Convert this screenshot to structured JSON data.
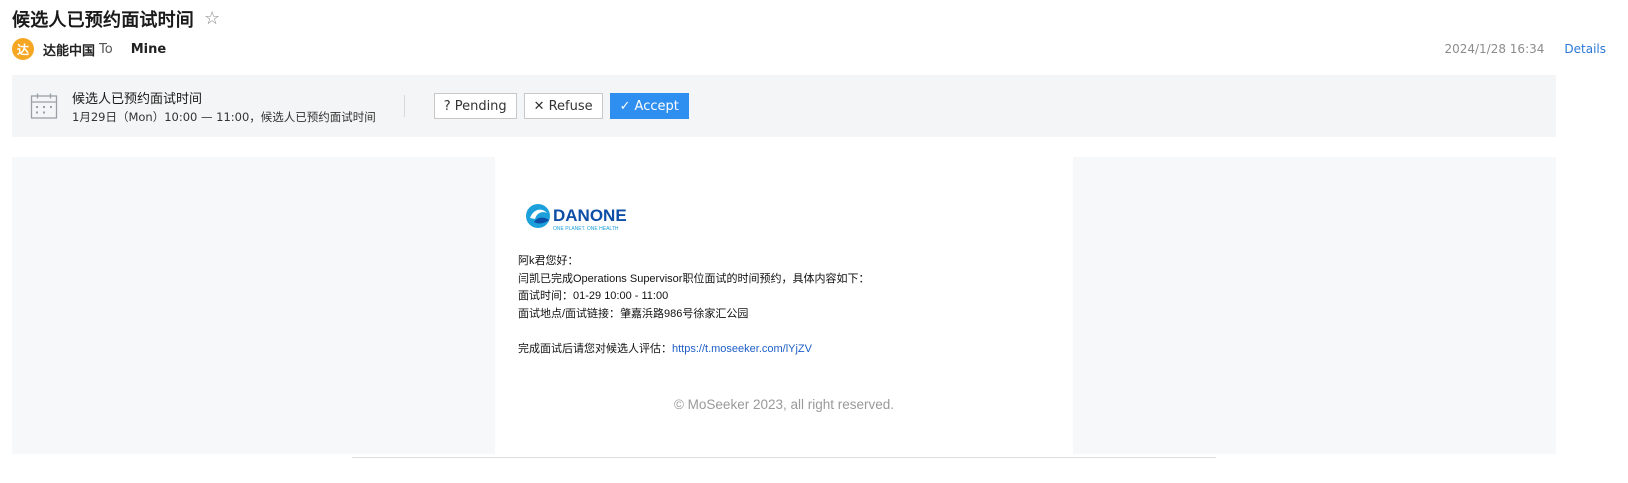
{
  "email": {
    "subject": "候选人已预约面试时间",
    "star_icon": "star-outline-icon",
    "sender": {
      "avatar_text": "达",
      "name": "达能中国",
      "to_label": "To",
      "recipient": "Mine"
    },
    "date": "2024/1/28 16:34",
    "details_label": "Details"
  },
  "invite": {
    "icon": "calendar-icon",
    "title": "候选人已预约面试时间",
    "time": "1月29日（Mon）10:00 — 11:00，候选人已预约面试时间",
    "buttons": {
      "pending": "Pending",
      "refuse": "Refuse",
      "accept": "Accept"
    },
    "pending_icon": "?",
    "refuse_icon": "✕",
    "accept_icon": "✓"
  },
  "message": {
    "logo": {
      "brand": "DANONE",
      "tagline": "ONE PLANET. ONE HEALTH"
    },
    "greeting": "阿k君您好：",
    "line1": "闫凯已完成Operations Supervisor职位面试的时间预约，具体内容如下：",
    "interview_time_label": "面试时间：",
    "interview_time": "01-29 10:00 - 11:00",
    "location_label": "面试地点/面试链接：",
    "location": "肇嘉浜路986号徐家汇公园",
    "eval_label": "完成面试后请您对候选人评估：",
    "eval_link": "https://t.moseeker.com/lYjZV",
    "copyright": "© MoSeeker 2023, all right reserved."
  },
  "colors": {
    "accent": "#2f8ff0",
    "avatar": "#f5a623",
    "link": "#1f5fc7",
    "brand": "#0d4ea6"
  }
}
